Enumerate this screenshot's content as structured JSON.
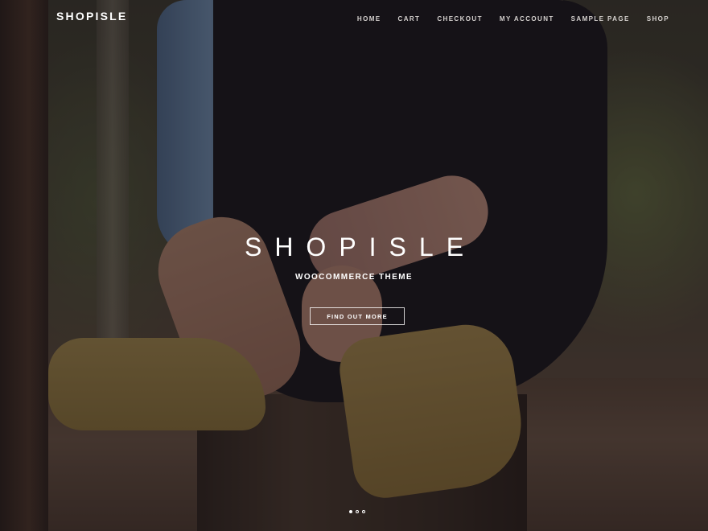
{
  "brand": {
    "logo": "SHOPISLE"
  },
  "nav": {
    "items": [
      {
        "label": "HOME"
      },
      {
        "label": "CART"
      },
      {
        "label": "CHECKOUT"
      },
      {
        "label": "MY ACCOUNT"
      },
      {
        "label": "SAMPLE PAGE"
      },
      {
        "label": "SHOP"
      }
    ]
  },
  "hero": {
    "title": "SHOPISLE",
    "subtitle": "WOOCOMMERCE THEME",
    "cta_label": "FIND OUT MORE",
    "slides_count": 3,
    "active_slide": 1
  }
}
